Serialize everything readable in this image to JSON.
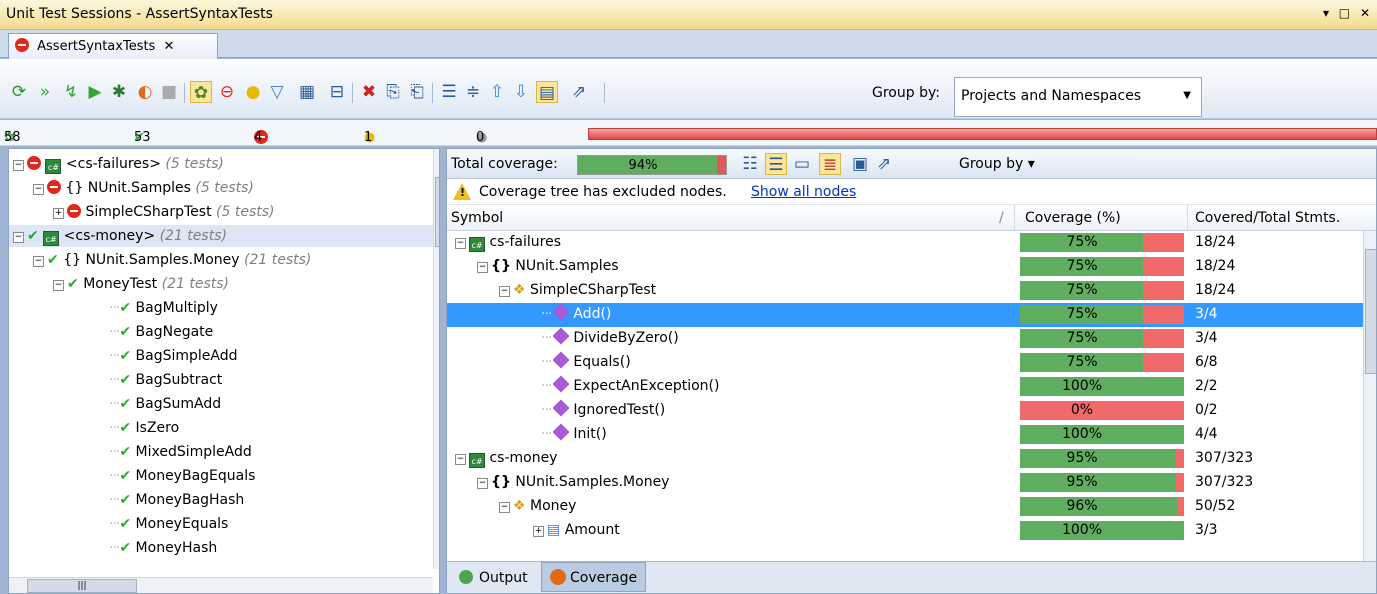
{
  "window": {
    "title": "Unit Test Sessions - AssertSyntaxTests",
    "controls": "▾ □ ✕"
  },
  "tab": {
    "label": "AssertSyntaxTests",
    "close": "✕"
  },
  "toolbar": {
    "group_by_label": "Group by:",
    "group_by_value": "Projects and Namespaces"
  },
  "counts": {
    "total": "58",
    "passed": "53",
    "failed": "4",
    "ignored": "1",
    "unknown": "0"
  },
  "test_tree": [
    {
      "label": "<cs-failures>",
      "note": "(5 tests)",
      "status": "failed"
    },
    {
      "label": "{} NUnit.Samples",
      "note": "(5 tests)",
      "status": "failed"
    },
    {
      "label": "SimpleCSharpTest",
      "note": "(5 tests)",
      "status": "failed"
    },
    {
      "label": "<cs-money>",
      "note": "(21 tests)",
      "status": "passed"
    },
    {
      "label": "{} NUnit.Samples.Money",
      "note": "(21 tests)",
      "status": "passed"
    },
    {
      "label": "MoneyTest",
      "note": "(21 tests)",
      "status": "passed"
    },
    {
      "label": "BagMultiply",
      "note": "",
      "status": "passed"
    },
    {
      "label": "BagNegate",
      "note": "",
      "status": "passed"
    },
    {
      "label": "BagSimpleAdd",
      "note": "",
      "status": "passed"
    },
    {
      "label": "BagSubtract",
      "note": "",
      "status": "passed"
    },
    {
      "label": "BagSumAdd",
      "note": "",
      "status": "passed"
    },
    {
      "label": "IsZero",
      "note": "",
      "status": "passed"
    },
    {
      "label": "MixedSimpleAdd",
      "note": "",
      "status": "passed"
    },
    {
      "label": "MoneyBagEquals",
      "note": "",
      "status": "passed"
    },
    {
      "label": "MoneyBagHash",
      "note": "",
      "status": "passed"
    },
    {
      "label": "MoneyEquals",
      "note": "",
      "status": "passed"
    },
    {
      "label": "MoneyHash",
      "note": "",
      "status": "passed"
    }
  ],
  "coverage": {
    "total_label": "Total coverage:",
    "total_pct": "94%",
    "total_fraction": 0.94,
    "group_by": "Group by",
    "warning": "Coverage tree has excluded nodes.",
    "show_all": "Show all nodes",
    "columns": [
      "Symbol",
      "Coverage (%)",
      "Covered/Total Stmts."
    ],
    "rows": [
      {
        "symbol": "cs-failures",
        "pct": "75%",
        "value": 0.75,
        "stmts": "18/24"
      },
      {
        "symbol": "NUnit.Samples",
        "pct": "75%",
        "value": 0.75,
        "stmts": "18/24"
      },
      {
        "symbol": "SimpleCSharpTest",
        "pct": "75%",
        "value": 0.75,
        "stmts": "18/24"
      },
      {
        "symbol": "Add()",
        "pct": "75%",
        "value": 0.75,
        "stmts": "3/4"
      },
      {
        "symbol": "DivideByZero()",
        "pct": "75%",
        "value": 0.75,
        "stmts": "3/4"
      },
      {
        "symbol": "Equals()",
        "pct": "75%",
        "value": 0.75,
        "stmts": "6/8"
      },
      {
        "symbol": "ExpectAnException()",
        "pct": "100%",
        "value": 1.0,
        "stmts": "2/2"
      },
      {
        "symbol": "IgnoredTest()",
        "pct": "0%",
        "value": 0.0,
        "stmts": "0/2"
      },
      {
        "symbol": "Init()",
        "pct": "100%",
        "value": 1.0,
        "stmts": "4/4"
      },
      {
        "symbol": "cs-money",
        "pct": "95%",
        "value": 0.95,
        "stmts": "307/323"
      },
      {
        "symbol": "NUnit.Samples.Money",
        "pct": "95%",
        "value": 0.95,
        "stmts": "307/323"
      },
      {
        "symbol": "Money",
        "pct": "96%",
        "value": 0.96,
        "stmts": "50/52"
      },
      {
        "symbol": "Amount",
        "pct": "100%",
        "value": 1.0,
        "stmts": "3/3"
      }
    ]
  },
  "bottom_tabs": {
    "output": "Output",
    "coverage": "Coverage"
  }
}
